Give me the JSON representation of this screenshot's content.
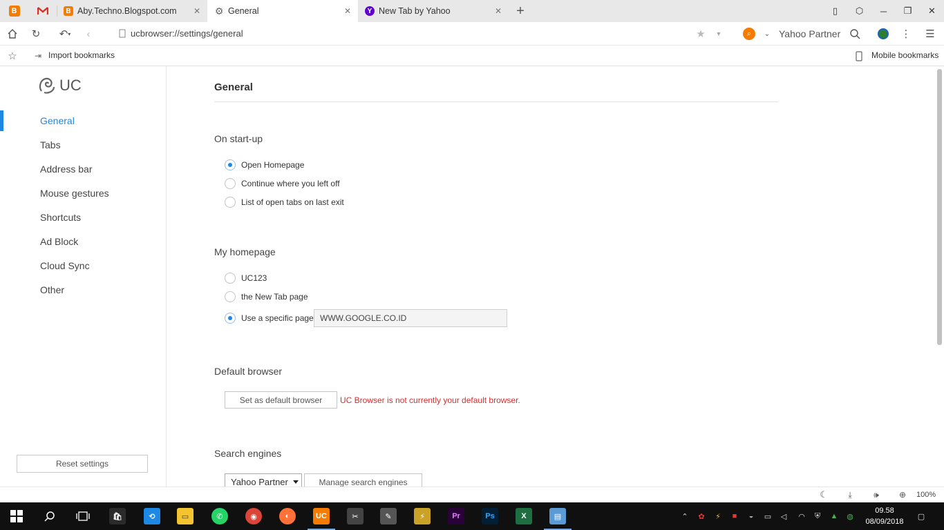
{
  "tabs": [
    {
      "title": "Aby.Techno.Blogspot.com",
      "favicon": "blogger-icon",
      "active": false
    },
    {
      "title": "General",
      "favicon": "settings-gear-icon",
      "active": true
    },
    {
      "title": "New Tab by Yahoo",
      "favicon": "yahoo-icon",
      "active": false
    }
  ],
  "address": {
    "url": "ucbrowser://settings/general",
    "search_provider": "Yahoo Partner"
  },
  "bookmarks": {
    "import_label": "Import bookmarks",
    "mobile_label": "Mobile bookmarks"
  },
  "sidebar": {
    "logo_text": "UC",
    "items": [
      {
        "label": "General",
        "active": true
      },
      {
        "label": "Tabs"
      },
      {
        "label": "Address bar"
      },
      {
        "label": "Mouse gestures"
      },
      {
        "label": "Shortcuts"
      },
      {
        "label": "Ad Block"
      },
      {
        "label": "Cloud Sync"
      },
      {
        "label": "Other"
      }
    ],
    "reset_label": "Reset settings"
  },
  "main": {
    "title": "General",
    "startup": {
      "heading": "On start-up",
      "options": [
        "Open Homepage",
        "Continue where you left off",
        "List of open tabs on last exit"
      ],
      "selected": 0
    },
    "homepage": {
      "heading": "My homepage",
      "options": [
        "UC123",
        "the New Tab page",
        "Use a specific page"
      ],
      "selected": 2,
      "url_value": "WWW.GOOGLE.CO.ID"
    },
    "default_browser": {
      "heading": "Default browser",
      "button_label": "Set as default browser",
      "warning": "UC Browser is not currently your default browser."
    },
    "search_engines": {
      "heading": "Search engines",
      "selected": "Yahoo Partner",
      "manage_label": "Manage search engines"
    }
  },
  "status": {
    "zoom": "100%"
  },
  "taskbar": {
    "time": "09.58",
    "date": "08/09/2018"
  },
  "colors": {
    "accent": "#1e88e5",
    "warning": "#d32f2f"
  }
}
